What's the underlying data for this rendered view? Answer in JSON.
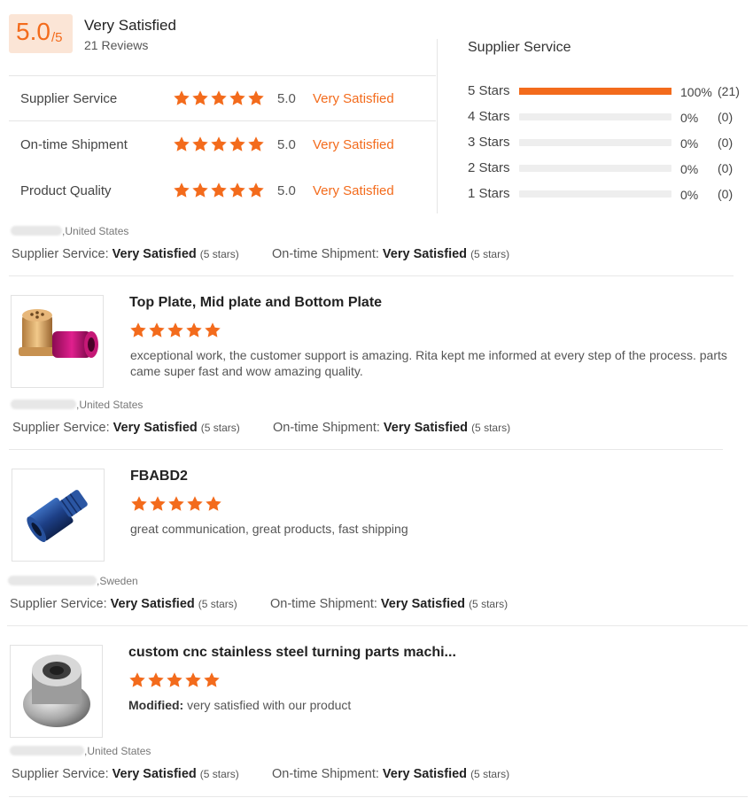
{
  "summary": {
    "score": "5.0",
    "score_denominator": "/5",
    "title": "Very Satisfied",
    "reviews_count": "21 Reviews"
  },
  "ratings": [
    {
      "label": "Supplier Service",
      "stars": 5,
      "score": "5.0",
      "satisfaction": "Very Satisfied"
    },
    {
      "label": "On-time Shipment",
      "stars": 5,
      "score": "5.0",
      "satisfaction": "Very Satisfied"
    },
    {
      "label": "Product Quality",
      "stars": 5,
      "score": "5.0",
      "satisfaction": "Very Satisfied"
    }
  ],
  "distribution": {
    "title": "Supplier Service",
    "rows": [
      {
        "label": "5 Stars",
        "fraction": 1.0,
        "percent": "100%",
        "count": "(21)"
      },
      {
        "label": "4 Stars",
        "fraction": 0,
        "percent": "0%",
        "count": "(0)"
      },
      {
        "label": "3 Stars",
        "fraction": 0,
        "percent": "0%",
        "count": "(0)"
      },
      {
        "label": "2 Stars",
        "fraction": 0,
        "percent": "0%",
        "count": "(0)"
      },
      {
        "label": "1 Stars",
        "fraction": 0,
        "percent": "0%",
        "count": "(0)"
      }
    ]
  },
  "labels": {
    "supplier_service": "Supplier Service:",
    "ontime_shipment": "On-time Shipment:",
    "very_satisfied": "Very Satisfied",
    "five_stars": "(5 stars)",
    "modified": "Modified:"
  },
  "reviews": [
    {
      "country": ",United States"
    },
    {
      "country": ",United States",
      "product_title": "Top Plate, Mid plate and Bottom Plate",
      "stars": 5,
      "text": "exceptional work, the customer support is amazing. Rita kept me informed at every step of the process.  parts came super fast and wow amazing quality."
    },
    {
      "country": ",Sweden",
      "product_title": "FBABD2",
      "stars": 5,
      "text": "great communication, great products, fast shipping"
    },
    {
      "country": ",United States",
      "product_title": "custom cnc stainless steel turning parts machi...",
      "stars": 5,
      "text": "very satisfied with our product"
    }
  ],
  "colors": {
    "accent": "#f36b1c",
    "score_bg": "#fbe5d6",
    "bar_track": "#eeeeee"
  }
}
